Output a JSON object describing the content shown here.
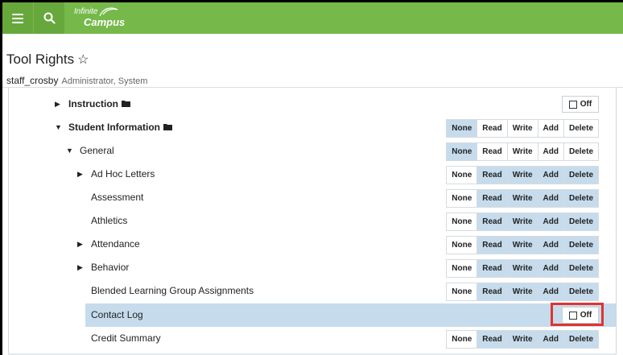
{
  "topbar": {
    "logo_line1": "Infinite",
    "logo_line2": "Campus"
  },
  "header": {
    "title": "Tool Rights",
    "user": "staff_crosby",
    "role": "Administrator, System"
  },
  "rights_labels": [
    "None",
    "Read",
    "Write",
    "Add",
    "Delete"
  ],
  "off_label": "Off",
  "colors": {
    "topbar": "#76b94a",
    "highlight": "#c6dced",
    "callout": "#e0342f"
  },
  "rows": [
    {
      "label": "Instruction",
      "control": "off"
    },
    {
      "label": "Student Information",
      "selected": "None"
    },
    {
      "label": "General",
      "selected": "None"
    },
    {
      "label": "Ad Hoc Letters",
      "selected": "Read, Write, Add, Delete"
    },
    {
      "label": "Assessment",
      "selected": "Read, Write, Add, Delete"
    },
    {
      "label": "Athletics",
      "selected": "Read, Write, Add, Delete"
    },
    {
      "label": "Attendance",
      "selected": "Read, Write, Add, Delete"
    },
    {
      "label": "Behavior",
      "selected": "Read, Write, Add, Delete"
    },
    {
      "label": "Blended Learning Group Assignments",
      "selected": "Read, Write, Add, Delete"
    },
    {
      "label": "Contact Log",
      "control": "off",
      "highlighted": true
    },
    {
      "label": "Credit Summary",
      "selected": "Read, Write, Add, Delete"
    }
  ]
}
